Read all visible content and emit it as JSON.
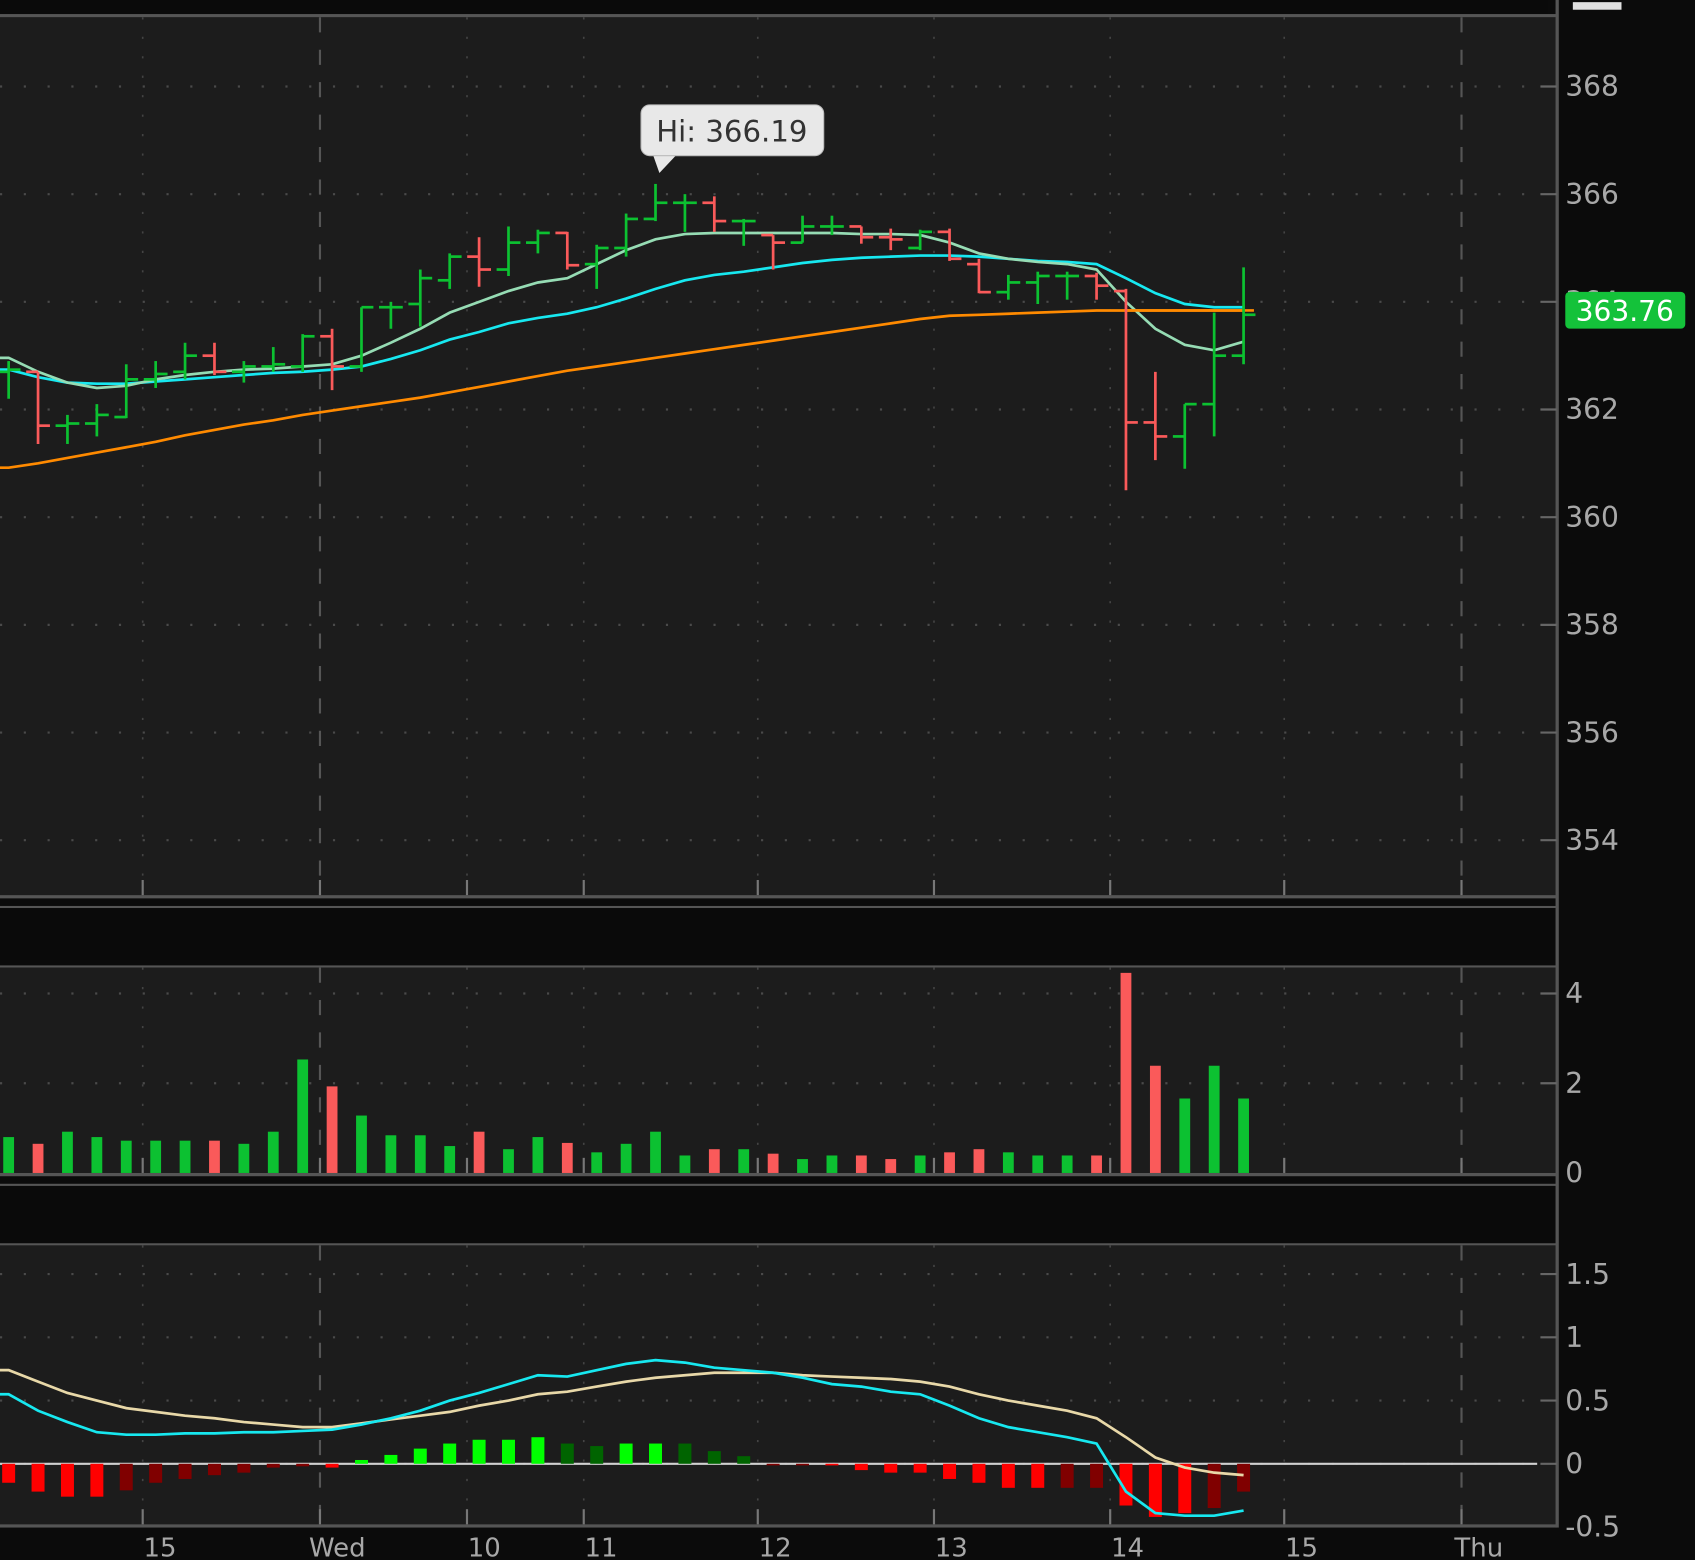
{
  "colors": {
    "up": "#0cc131",
    "down": "#fa5a5a",
    "ma_fast": "#96dcb4",
    "ma_mid": "#17e8f0",
    "ma_slow": "#ff8a00",
    "macd_value": "#17e8f0",
    "macd_avg": "#e8d8a8",
    "hist_up_rising": "#00ff00",
    "hist_up_falling": "#006400",
    "hist_down_falling": "#ff0000",
    "hist_down_rising": "#800000",
    "last_price_bg": "#14c23a"
  },
  "chart_data": [
    {
      "type": "ohlc",
      "panel": "price",
      "ylim": [
        353,
        369.5
      ],
      "yticks": [
        "368",
        "366",
        "364",
        "362",
        "360",
        "358",
        "356",
        "354"
      ],
      "ytick_values": [
        368,
        366,
        364,
        362,
        360,
        358,
        356,
        354
      ],
      "last_price": "363.76",
      "high_label": "Hi: 366.19",
      "high_bar_index": 22,
      "bars": [
        [
          362.7,
          362.9,
          362.2,
          362.74
        ],
        [
          362.7,
          362.7,
          361.36,
          361.7
        ],
        [
          361.7,
          361.9,
          361.36,
          361.74
        ],
        [
          361.74,
          362.1,
          361.5,
          361.9
        ],
        [
          361.86,
          362.84,
          361.84,
          362.56
        ],
        [
          362.56,
          362.9,
          362.4,
          362.66
        ],
        [
          362.7,
          363.24,
          362.56,
          363.0
        ],
        [
          363.0,
          363.24,
          362.64,
          362.7
        ],
        [
          362.7,
          362.9,
          362.5,
          362.8
        ],
        [
          362.8,
          363.16,
          362.7,
          362.84
        ],
        [
          362.8,
          363.4,
          362.7,
          363.36
        ],
        [
          363.36,
          363.5,
          362.36,
          362.8
        ],
        [
          362.8,
          363.9,
          362.7,
          363.9
        ],
        [
          363.9,
          364.0,
          363.5,
          363.9
        ],
        [
          363.96,
          364.6,
          363.54,
          364.44
        ],
        [
          364.4,
          364.9,
          364.24,
          364.84
        ],
        [
          364.84,
          365.2,
          364.28,
          364.6
        ],
        [
          364.6,
          365.4,
          364.48,
          365.1
        ],
        [
          365.1,
          365.34,
          364.9,
          365.28
        ],
        [
          365.28,
          365.3,
          364.6,
          364.68
        ],
        [
          364.7,
          365.06,
          364.24,
          365.0
        ],
        [
          365.0,
          365.64,
          364.84,
          365.54
        ],
        [
          365.54,
          366.19,
          365.5,
          365.84
        ],
        [
          365.84,
          366.0,
          365.3,
          365.84
        ],
        [
          365.84,
          365.96,
          365.3,
          365.5
        ],
        [
          365.5,
          365.54,
          365.04,
          365.5
        ],
        [
          365.24,
          365.24,
          364.6,
          365.1
        ],
        [
          365.1,
          365.6,
          365.1,
          365.4
        ],
        [
          365.4,
          365.6,
          365.24,
          365.4
        ],
        [
          365.4,
          365.4,
          365.08,
          365.2
        ],
        [
          365.2,
          365.36,
          364.96,
          365.16
        ],
        [
          365.0,
          365.34,
          364.96,
          365.3
        ],
        [
          365.3,
          365.36,
          364.76,
          364.8
        ],
        [
          364.7,
          364.8,
          364.16,
          364.18
        ],
        [
          364.18,
          364.5,
          364.04,
          364.36
        ],
        [
          364.36,
          364.56,
          363.96,
          364.48
        ],
        [
          364.48,
          364.56,
          364.04,
          364.48
        ],
        [
          364.48,
          364.54,
          364.04,
          364.3
        ],
        [
          364.2,
          364.24,
          360.5,
          361.76
        ],
        [
          361.76,
          362.7,
          361.06,
          361.5
        ],
        [
          361.5,
          362.1,
          360.9,
          362.1
        ],
        [
          362.1,
          363.8,
          361.5,
          363.0
        ],
        [
          363.0,
          364.64,
          362.84,
          363.76
        ]
      ],
      "series": [
        {
          "name": "ma_fast",
          "values": [
            362.96,
            362.7,
            362.5,
            362.4,
            362.44,
            362.56,
            362.64,
            362.7,
            362.74,
            362.76,
            362.8,
            362.84,
            363.0,
            363.24,
            363.5,
            363.8,
            364.0,
            364.2,
            364.36,
            364.44,
            364.7,
            364.96,
            365.16,
            365.26,
            365.28,
            365.28,
            365.28,
            365.28,
            365.28,
            365.26,
            365.26,
            365.24,
            365.1,
            364.9,
            364.8,
            364.74,
            364.7,
            364.6,
            364.0,
            363.5,
            363.2,
            363.1,
            363.26
          ]
        },
        {
          "name": "ma_mid",
          "values": [
            362.74,
            362.6,
            362.5,
            362.48,
            362.48,
            362.52,
            362.56,
            362.6,
            362.64,
            362.68,
            362.7,
            362.74,
            362.8,
            362.94,
            363.1,
            363.3,
            363.44,
            363.6,
            363.7,
            363.78,
            363.9,
            364.06,
            364.24,
            364.4,
            364.5,
            364.56,
            364.64,
            364.72,
            364.78,
            364.82,
            364.84,
            364.86,
            364.86,
            364.84,
            364.8,
            364.76,
            364.74,
            364.7,
            364.44,
            364.16,
            363.96,
            363.9,
            363.9
          ]
        },
        {
          "name": "ma_slow",
          "values": [
            360.92,
            361.0,
            361.1,
            361.2,
            361.3,
            361.4,
            361.52,
            361.62,
            361.72,
            361.8,
            361.9,
            361.98,
            362.06,
            362.14,
            362.22,
            362.32,
            362.42,
            362.52,
            362.62,
            362.72,
            362.8,
            362.88,
            362.96,
            363.04,
            363.12,
            363.2,
            363.28,
            363.36,
            363.44,
            363.52,
            363.6,
            363.68,
            363.74,
            363.76,
            363.78,
            363.8,
            363.82,
            363.84,
            363.84,
            363.84,
            363.84,
            363.84,
            363.84
          ]
        }
      ]
    },
    {
      "type": "bar",
      "panel": "volume",
      "ylim": [
        0,
        4.5
      ],
      "yticks": [
        "4",
        "2",
        "0"
      ],
      "ytick_values": [
        4,
        2,
        0
      ],
      "values": [
        0.8,
        0.65,
        0.92,
        0.8,
        0.72,
        0.72,
        0.72,
        0.72,
        0.65,
        0.92,
        2.53,
        1.93,
        1.28,
        0.84,
        0.84,
        0.6,
        0.92,
        0.53,
        0.8,
        0.67,
        0.46,
        0.65,
        0.92,
        0.39,
        0.53,
        0.53,
        0.43,
        0.31,
        0.39,
        0.39,
        0.31,
        0.39,
        0.46,
        0.53,
        0.46,
        0.39,
        0.39,
        0.39,
        4.46,
        2.39,
        1.66,
        2.39,
        1.66
      ]
    },
    {
      "type": "line+histogram",
      "panel": "macd",
      "ylim": [
        -0.5,
        1.7
      ],
      "yticks": [
        "1.5",
        "1",
        "0.5",
        "0",
        "-0.5"
      ],
      "ytick_values": [
        1.5,
        1,
        0.5,
        0,
        -0.5
      ],
      "histogram": [
        -0.15,
        -0.22,
        -0.26,
        -0.26,
        -0.21,
        -0.15,
        -0.12,
        -0.09,
        -0.07,
        -0.03,
        -0.02,
        -0.03,
        0.03,
        0.07,
        0.12,
        0.16,
        0.19,
        0.19,
        0.21,
        0.16,
        0.14,
        0.16,
        0.16,
        0.16,
        0.1,
        0.06,
        -0.01,
        0.0,
        -0.01,
        -0.05,
        -0.07,
        -0.07,
        -0.12,
        -0.15,
        -0.19,
        -0.19,
        -0.19,
        -0.19,
        -0.33,
        -0.42,
        -0.39,
        -0.35,
        -0.22
      ],
      "histogram_state": [
        "dn",
        "dn",
        "dn",
        "dn",
        "dr",
        "dr",
        "dr",
        "dr",
        "dr",
        "dr",
        "dr",
        "dn",
        "ur",
        "ur",
        "ur",
        "ur",
        "ur",
        "ur",
        "ur",
        "uf",
        "uf",
        "ur",
        "ur",
        "uf",
        "uf",
        "uf",
        "dr",
        "dr",
        "dn",
        "dn",
        "dn",
        "dn",
        "dn",
        "dn",
        "dn",
        "dn",
        "dr",
        "dr",
        "dn",
        "dn",
        "dn",
        "dr",
        "dr"
      ],
      "series": [
        {
          "name": "macd_value",
          "values": [
            0.55,
            0.42,
            0.33,
            0.25,
            0.23,
            0.23,
            0.24,
            0.24,
            0.25,
            0.25,
            0.26,
            0.27,
            0.31,
            0.36,
            0.42,
            0.5,
            0.56,
            0.63,
            0.7,
            0.69,
            0.74,
            0.79,
            0.82,
            0.8,
            0.76,
            0.74,
            0.72,
            0.68,
            0.63,
            0.61,
            0.57,
            0.55,
            0.46,
            0.36,
            0.29,
            0.25,
            0.21,
            0.16,
            -0.22,
            -0.39,
            -0.41,
            -0.41,
            -0.37
          ]
        },
        {
          "name": "macd_avg",
          "values": [
            0.74,
            0.65,
            0.56,
            0.5,
            0.44,
            0.41,
            0.38,
            0.36,
            0.33,
            0.31,
            0.29,
            0.29,
            0.32,
            0.35,
            0.38,
            0.41,
            0.46,
            0.5,
            0.55,
            0.57,
            0.61,
            0.65,
            0.68,
            0.7,
            0.72,
            0.72,
            0.72,
            0.7,
            0.69,
            0.68,
            0.67,
            0.65,
            0.61,
            0.55,
            0.5,
            0.46,
            0.42,
            0.36,
            0.21,
            0.05,
            -0.03,
            -0.07,
            -0.09
          ]
        }
      ]
    }
  ],
  "xaxis": {
    "labels": [
      "15",
      "Wed",
      "10",
      "11",
      "12",
      "13",
      "14",
      "15",
      "Thu"
    ],
    "dashed": [
      false,
      true,
      false,
      false,
      false,
      false,
      false,
      false,
      true
    ]
  }
}
